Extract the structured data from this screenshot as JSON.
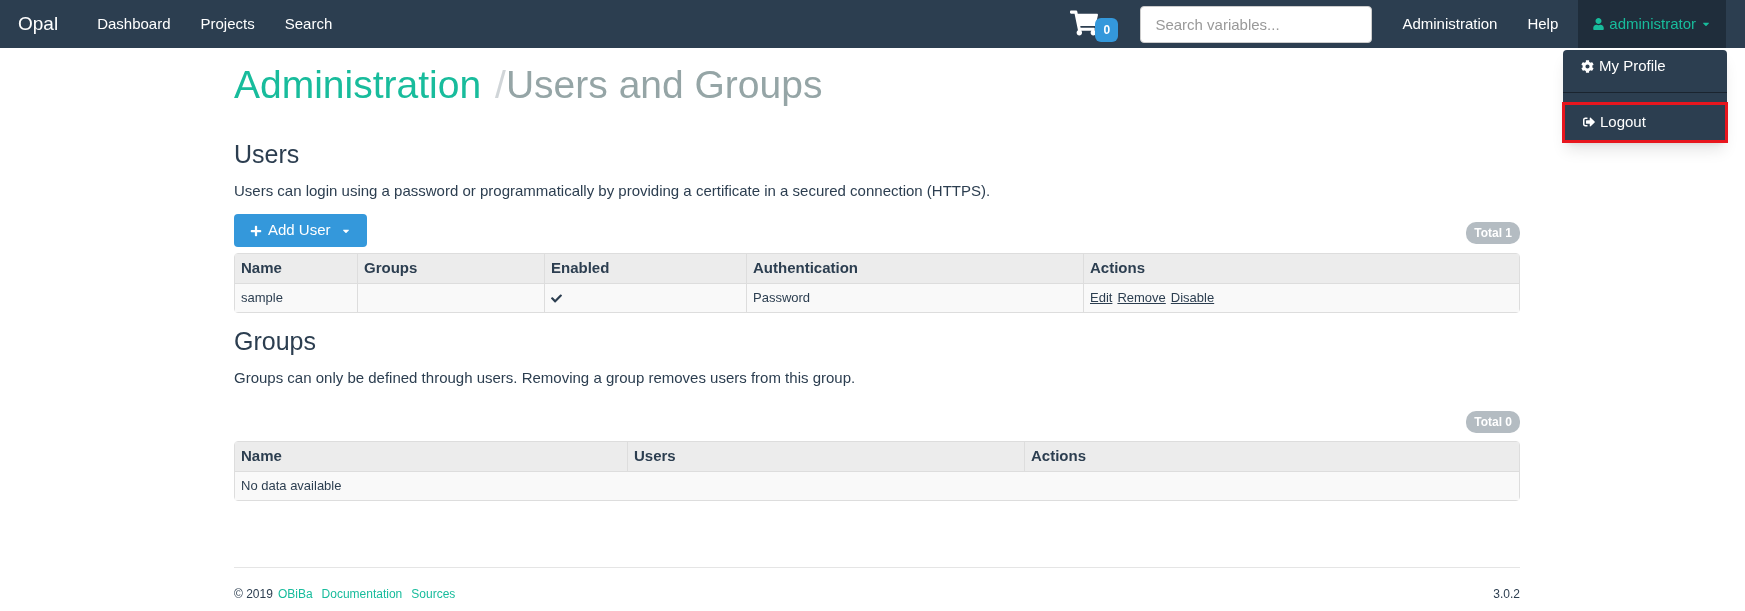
{
  "navbar": {
    "brand": "Opal",
    "links": [
      "Dashboard",
      "Projects",
      "Search"
    ],
    "cart_count": "0",
    "search": {
      "placeholder": "Search variables..."
    },
    "right_links": [
      "Administration",
      "Help"
    ],
    "user": "administrator"
  },
  "user_menu": {
    "items": [
      {
        "label": "My Profile",
        "kind": "profile",
        "highlighted": false
      },
      {
        "label": "Logout",
        "kind": "logout",
        "highlighted": true
      }
    ]
  },
  "breadcrumb": {
    "parent": "Administration",
    "separator": "/",
    "current": "Users and Groups"
  },
  "users": {
    "heading": "Users",
    "description": "Users can login using a password or programmatically by providing a certificate in a secured connection (HTTPS).",
    "add_button": "Add User",
    "total": "Total 1",
    "columns": [
      "Name",
      "Groups",
      "Enabled",
      "Authentication",
      "Actions"
    ],
    "rows": [
      {
        "name": "sample",
        "groups": "",
        "enabled": true,
        "authentication": "Password",
        "actions": [
          "Edit",
          "Remove",
          "Disable"
        ]
      }
    ]
  },
  "groups": {
    "heading": "Groups",
    "description": "Groups can only be defined through users. Removing a group removes users from this group.",
    "total": "Total 0",
    "columns": [
      "Name",
      "Users",
      "Actions"
    ],
    "empty_text": "No data available"
  },
  "footer": {
    "copyright": "© 2019",
    "links": [
      "OBiBa",
      "Documentation",
      "Sources"
    ],
    "version": "3.0.2"
  }
}
